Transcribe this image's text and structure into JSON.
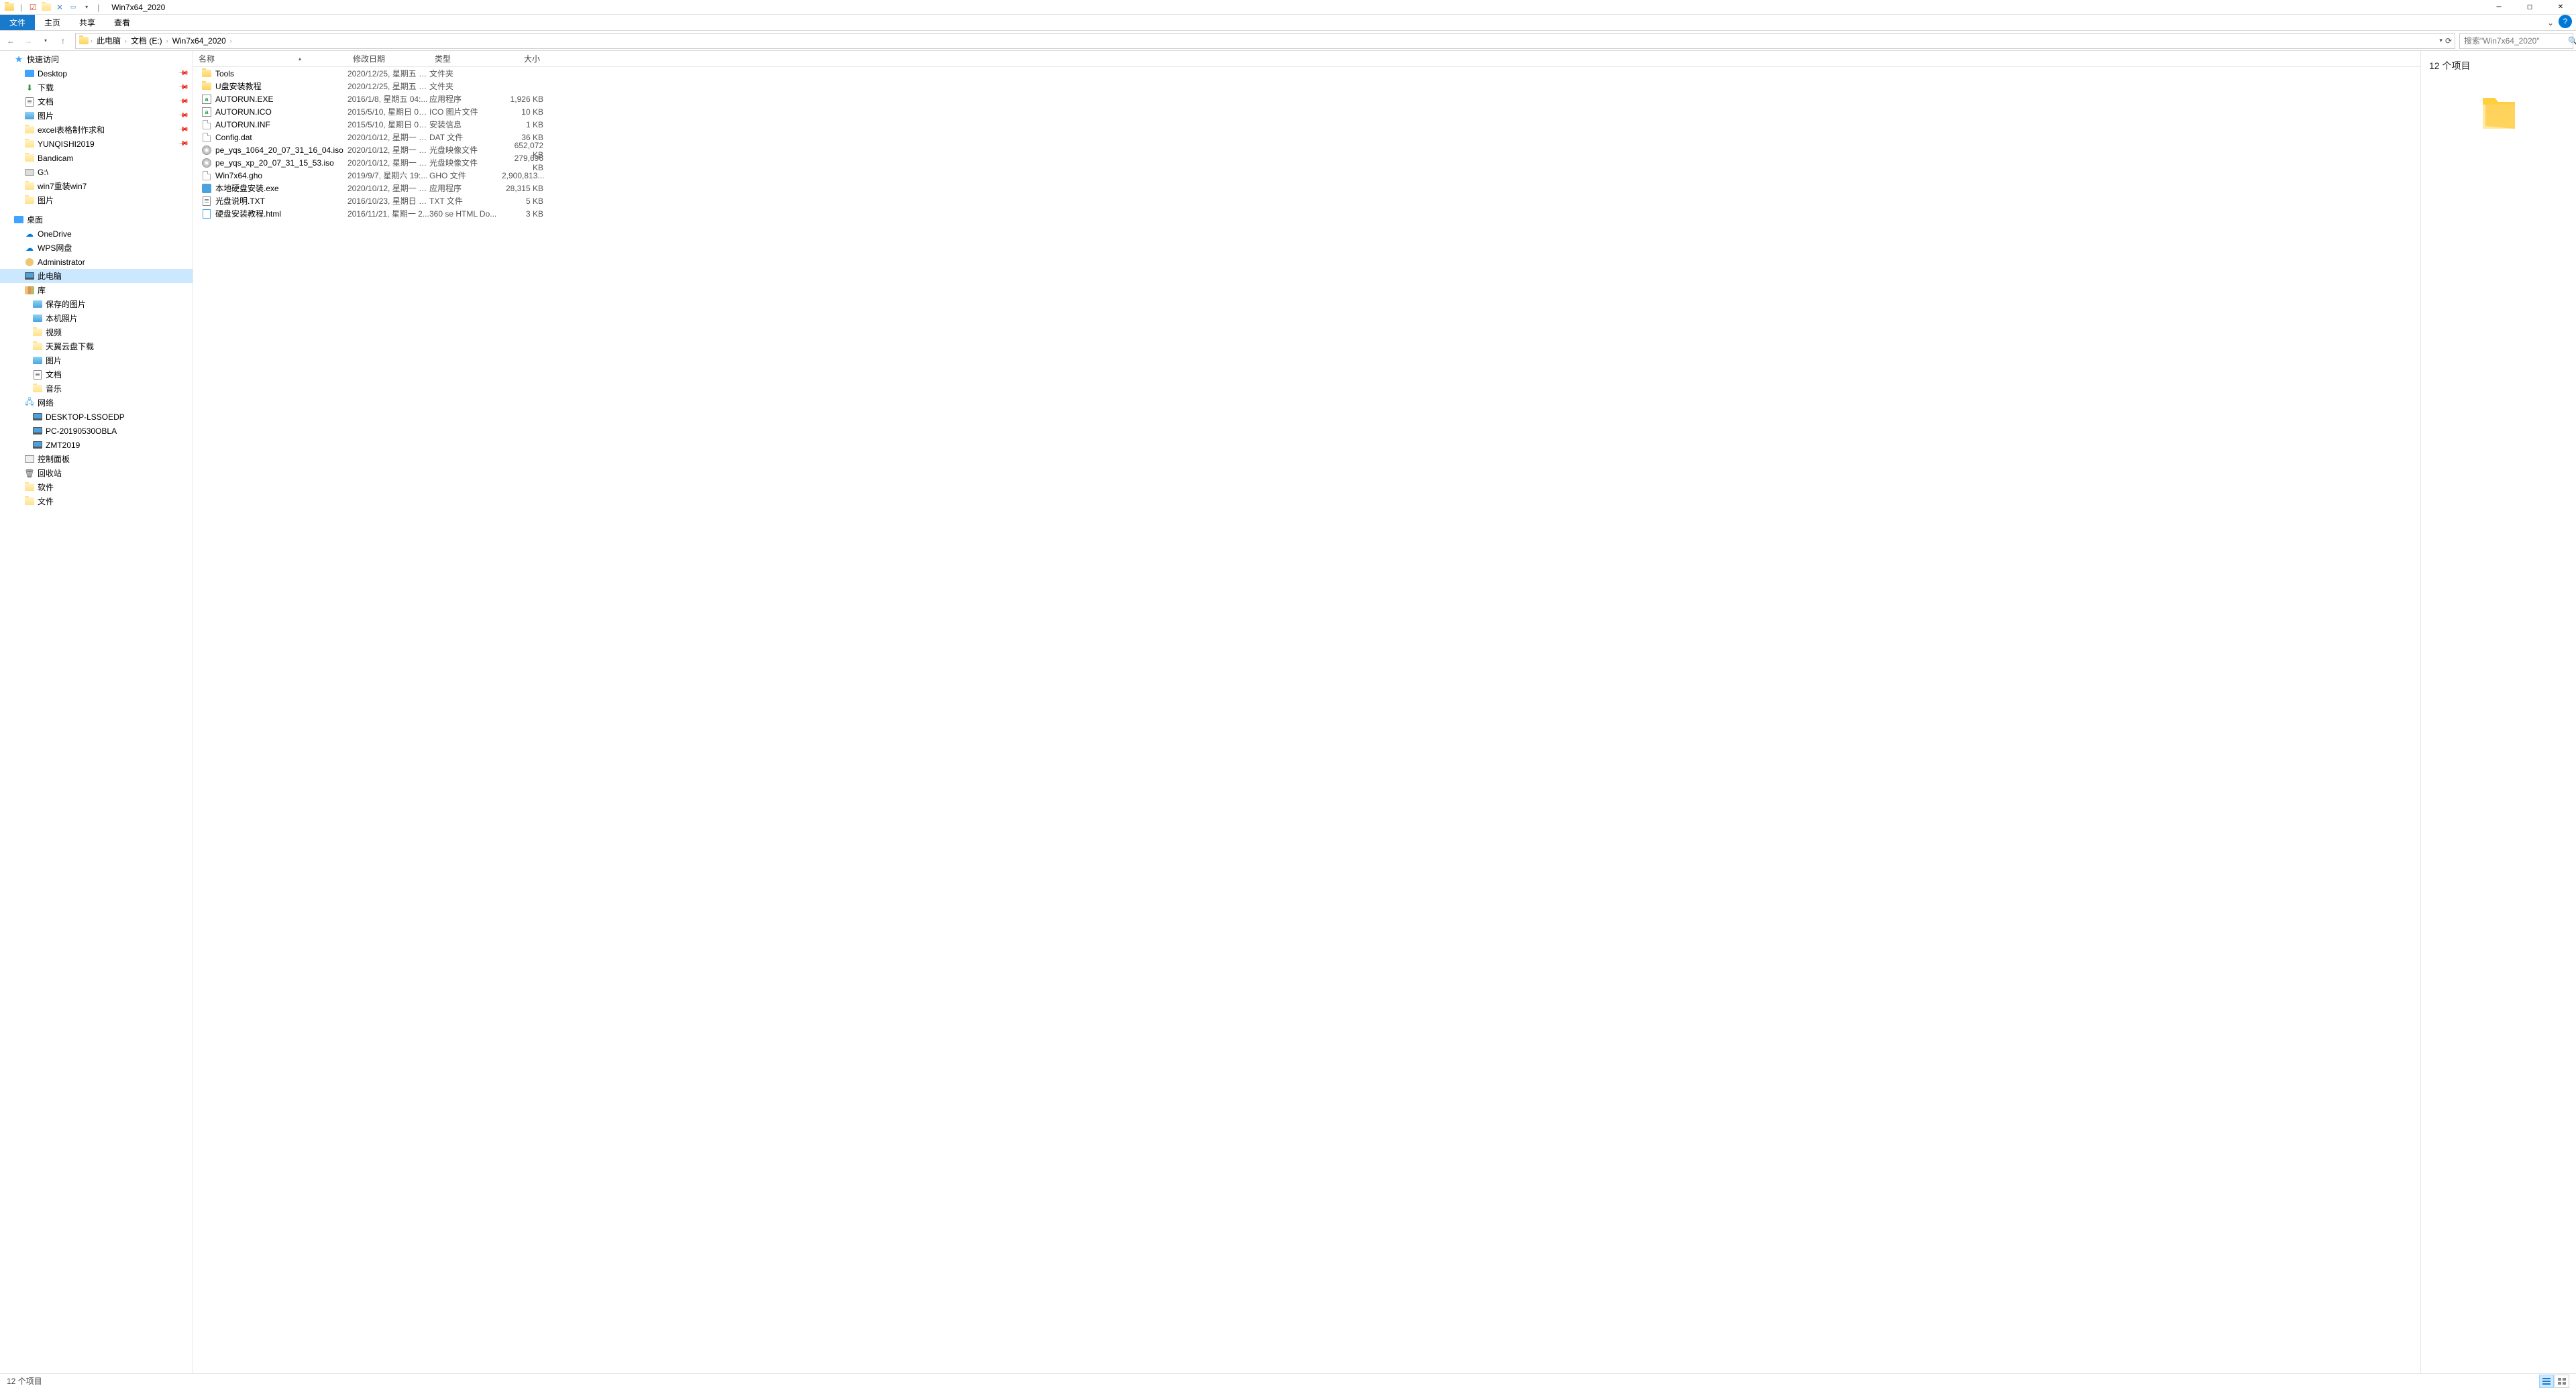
{
  "window": {
    "title": "Win7x64_2020",
    "qat": {
      "sep": "|"
    }
  },
  "ribbon": {
    "file": "文件",
    "tabs": [
      "主页",
      "共享",
      "查看"
    ]
  },
  "nav": {
    "back": "←",
    "forward": "→",
    "up": "↑",
    "dropdown": "▾",
    "refresh": "⟳"
  },
  "breadcrumbs": [
    "此电脑",
    "文档 (E:)",
    "Win7x64_2020"
  ],
  "search": {
    "placeholder": "搜索\"Win7x64_2020\""
  },
  "tree": [
    {
      "label": "快速访问",
      "level": 1,
      "iconClass": "ic-star",
      "glyph": "★"
    },
    {
      "label": "Desktop",
      "level": 2,
      "iconClass": "ic-desktop",
      "pinned": true
    },
    {
      "label": "下载",
      "level": 2,
      "iconClass": "ic-down",
      "glyph": "⬇",
      "pinned": true
    },
    {
      "label": "文档",
      "level": 2,
      "iconClass": "ic-txt",
      "pinned": true
    },
    {
      "label": "图片",
      "level": 2,
      "iconClass": "ic-pic",
      "pinned": true
    },
    {
      "label": "excel表格制作求和",
      "level": 2,
      "iconClass": "ic-folder-dim",
      "pinned": true
    },
    {
      "label": "YUNQISHI2019",
      "level": 2,
      "iconClass": "ic-folder-dim",
      "pinned": true
    },
    {
      "label": "Bandicam",
      "level": 2,
      "iconClass": "ic-folder-dim"
    },
    {
      "label": "G:\\",
      "level": 2,
      "iconClass": "ic-drive"
    },
    {
      "label": "win7重装win7",
      "level": 2,
      "iconClass": "ic-folder-dim"
    },
    {
      "label": "图片",
      "level": 2,
      "iconClass": "ic-folder-dim"
    },
    {
      "spacer": true
    },
    {
      "label": "桌面",
      "level": 1,
      "iconClass": "ic-desktop"
    },
    {
      "label": "OneDrive",
      "level": 2,
      "iconClass": "ic-cloud",
      "glyph": "☁"
    },
    {
      "label": "WPS网盘",
      "level": 2,
      "iconClass": "ic-cloud",
      "glyph": "☁"
    },
    {
      "label": "Administrator",
      "level": 2,
      "iconClass": "ic-user"
    },
    {
      "label": "此电脑",
      "level": 2,
      "iconClass": "ic-pc",
      "selected": true
    },
    {
      "label": "库",
      "level": 2,
      "iconClass": "ic-lib"
    },
    {
      "label": "保存的图片",
      "level": 3,
      "iconClass": "ic-pic"
    },
    {
      "label": "本机照片",
      "level": 3,
      "iconClass": "ic-pic"
    },
    {
      "label": "视频",
      "level": 3,
      "iconClass": "ic-folder-dim"
    },
    {
      "label": "天翼云盘下载",
      "level": 3,
      "iconClass": "ic-folder-dim"
    },
    {
      "label": "图片",
      "level": 3,
      "iconClass": "ic-pic"
    },
    {
      "label": "文档",
      "level": 3,
      "iconClass": "ic-txt"
    },
    {
      "label": "音乐",
      "level": 3,
      "iconClass": "ic-folder-dim"
    },
    {
      "label": "网络",
      "level": 2,
      "iconClass": "ic-net",
      "glyph": "🖧"
    },
    {
      "label": "DESKTOP-LSSOEDP",
      "level": 3,
      "iconClass": "ic-pc"
    },
    {
      "label": "PC-20190530OBLA",
      "level": 3,
      "iconClass": "ic-pc"
    },
    {
      "label": "ZMT2019",
      "level": 3,
      "iconClass": "ic-pc"
    },
    {
      "label": "控制面板",
      "level": 2,
      "iconClass": "ic-panel"
    },
    {
      "label": "回收站",
      "level": 2,
      "iconClass": "ic-recycle",
      "glyph": "🗑"
    },
    {
      "label": "软件",
      "level": 2,
      "iconClass": "ic-folder-dim"
    },
    {
      "label": "文件",
      "level": 2,
      "iconClass": "ic-folder-dim"
    }
  ],
  "columns": {
    "name": "名称",
    "date": "修改日期",
    "type": "类型",
    "size": "大小"
  },
  "files": [
    {
      "name": "Tools",
      "date": "2020/12/25, 星期五 1...",
      "type": "文件夹",
      "size": "",
      "icon": "ic-folder"
    },
    {
      "name": "U盘安装教程",
      "date": "2020/12/25, 星期五 1...",
      "type": "文件夹",
      "size": "",
      "icon": "ic-folder"
    },
    {
      "name": "AUTORUN.EXE",
      "date": "2016/1/8, 星期五 04:...",
      "type": "应用程序",
      "size": "1,926 KB",
      "icon": "ic-ico"
    },
    {
      "name": "AUTORUN.ICO",
      "date": "2015/5/10, 星期日 02...",
      "type": "ICO 图片文件",
      "size": "10 KB",
      "icon": "ic-ico"
    },
    {
      "name": "AUTORUN.INF",
      "date": "2015/5/10, 星期日 02...",
      "type": "安装信息",
      "size": "1 KB",
      "icon": "ic-file"
    },
    {
      "name": "Config.dat",
      "date": "2020/10/12, 星期一 1...",
      "type": "DAT 文件",
      "size": "36 KB",
      "icon": "ic-file"
    },
    {
      "name": "pe_yqs_1064_20_07_31_16_04.iso",
      "date": "2020/10/12, 星期一 1...",
      "type": "光盘映像文件",
      "size": "652,072 KB",
      "icon": "ic-disc"
    },
    {
      "name": "pe_yqs_xp_20_07_31_15_53.iso",
      "date": "2020/10/12, 星期一 1...",
      "type": "光盘映像文件",
      "size": "279,696 KB",
      "icon": "ic-disc"
    },
    {
      "name": "Win7x64.gho",
      "date": "2019/9/7, 星期六 19:...",
      "type": "GHO 文件",
      "size": "2,900,813...",
      "icon": "ic-file"
    },
    {
      "name": "本地硬盘安装.exe",
      "date": "2020/10/12, 星期一 1...",
      "type": "应用程序",
      "size": "28,315 KB",
      "icon": "ic-app"
    },
    {
      "name": "光盘说明.TXT",
      "date": "2016/10/23, 星期日 0...",
      "type": "TXT 文件",
      "size": "5 KB",
      "icon": "ic-txt"
    },
    {
      "name": "硬盘安装教程.html",
      "date": "2016/11/21, 星期一 2...",
      "type": "360 se HTML Do...",
      "size": "3 KB",
      "icon": "ic-html"
    }
  ],
  "preview": {
    "summary": "12 个项目"
  },
  "status": {
    "text": "12 个项目"
  }
}
